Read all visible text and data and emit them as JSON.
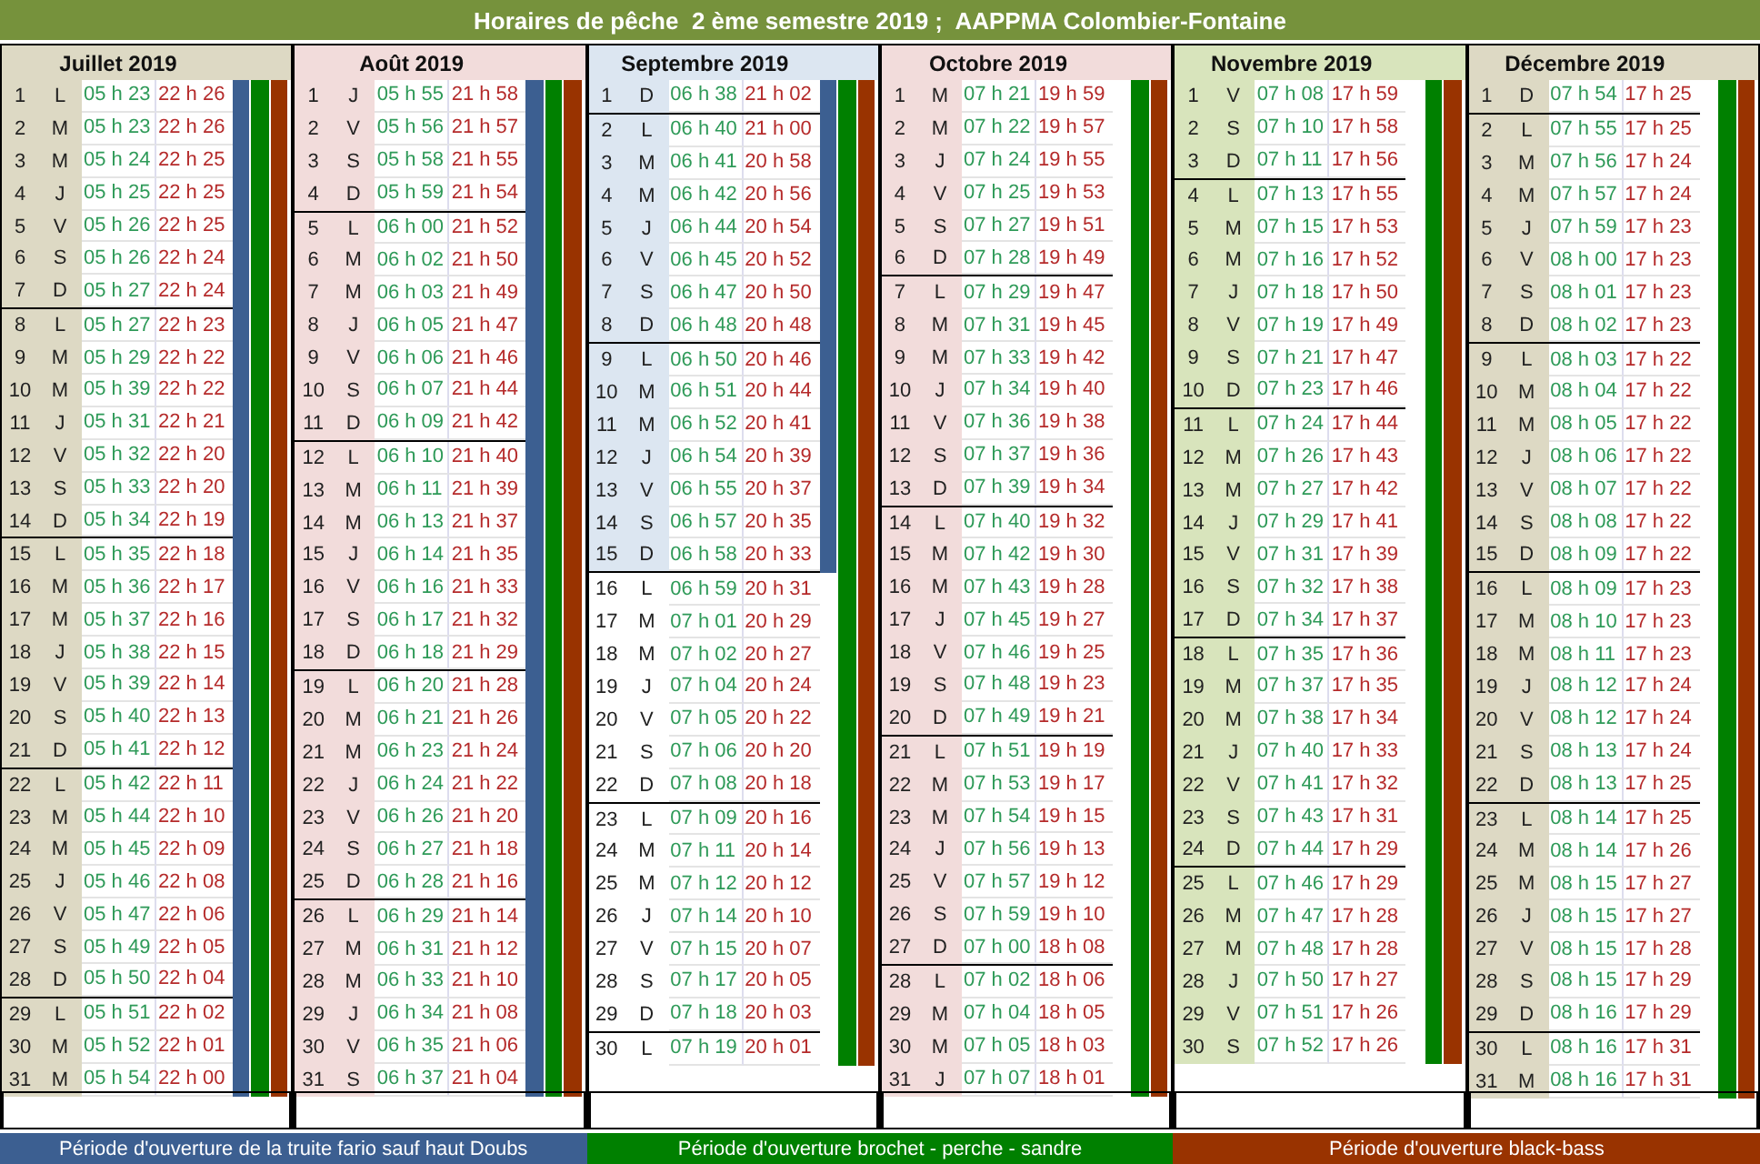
{
  "title": "Horaires de pêche  2 ème semestre 2019 ;  AAPPMA Colombier-Fontaine",
  "months": [
    {
      "name": "Juillet 2019",
      "color": "#ddd9c4",
      "weeks": [
        {
          "shaded": true,
          "trout_open": true,
          "pike_open": true,
          "bass_open": true,
          "days": [
            [
              "1",
              "L",
              "05 h 23",
              "22 h 26"
            ],
            [
              "2",
              "M",
              "05 h 23",
              "22 h 26"
            ],
            [
              "3",
              "M",
              "05 h 24",
              "22 h 25"
            ],
            [
              "4",
              "J",
              "05 h 25",
              "22 h 25"
            ],
            [
              "5",
              "V",
              "05 h 26",
              "22 h 25"
            ],
            [
              "6",
              "S",
              "05 h 26",
              "22 h 24"
            ],
            [
              "7",
              "D",
              "05 h 27",
              "22 h 24"
            ]
          ]
        },
        {
          "shaded": true,
          "trout_open": true,
          "pike_open": true,
          "bass_open": true,
          "days": [
            [
              "8",
              "L",
              "05 h 27",
              "22 h 23"
            ],
            [
              "9",
              "M",
              "05 h 29",
              "22 h 22"
            ],
            [
              "10",
              "M",
              "05 h 39",
              "22 h 22"
            ],
            [
              "11",
              "J",
              "05 h 31",
              "22 h 21"
            ],
            [
              "12",
              "V",
              "05 h 32",
              "22 h 20"
            ],
            [
              "13",
              "S",
              "05 h 33",
              "22 h 20"
            ],
            [
              "14",
              "D",
              "05 h 34",
              "22 h 19"
            ]
          ]
        },
        {
          "shaded": true,
          "trout_open": true,
          "pike_open": true,
          "bass_open": true,
          "days": [
            [
              "15",
              "L",
              "05 h 35",
              "22 h 18"
            ],
            [
              "16",
              "M",
              "05 h 36",
              "22 h 17"
            ],
            [
              "17",
              "M",
              "05 h 37",
              "22 h 16"
            ],
            [
              "18",
              "J",
              "05 h 38",
              "22 h 15"
            ],
            [
              "19",
              "V",
              "05 h 39",
              "22 h 14"
            ],
            [
              "20",
              "S",
              "05 h 40",
              "22 h 13"
            ],
            [
              "21",
              "D",
              "05 h 41",
              "22 h 12"
            ]
          ]
        },
        {
          "shaded": true,
          "trout_open": true,
          "pike_open": true,
          "bass_open": true,
          "days": [
            [
              "22",
              "L",
              "05 h 42",
              "22 h 11"
            ],
            [
              "23",
              "M",
              "05 h 44",
              "22 h 10"
            ],
            [
              "24",
              "M",
              "05 h 45",
              "22 h 09"
            ],
            [
              "25",
              "J",
              "05 h 46",
              "22 h 08"
            ],
            [
              "26",
              "V",
              "05 h 47",
              "22 h 06"
            ],
            [
              "27",
              "S",
              "05 h 49",
              "22 h 05"
            ],
            [
              "28",
              "D",
              "05 h 50",
              "22 h 04"
            ]
          ]
        },
        {
          "shaded": true,
          "trout_open": true,
          "pike_open": true,
          "bass_open": true,
          "days": [
            [
              "29",
              "L",
              "05 h 51",
              "22 h 02"
            ],
            [
              "30",
              "M",
              "05 h 52",
              "22 h 01"
            ],
            [
              "31",
              "M",
              "05 h 54",
              "22 h 00"
            ]
          ]
        }
      ]
    },
    {
      "name": "Août 2019",
      "color": "#f2dcdb",
      "weeks": [
        {
          "shaded": true,
          "trout_open": true,
          "pike_open": true,
          "bass_open": true,
          "days": [
            [
              "1",
              "J",
              "05 h 55",
              "21 h 58"
            ],
            [
              "2",
              "V",
              "05 h 56",
              "21 h 57"
            ],
            [
              "3",
              "S",
              "05 h 58",
              "21 h 55"
            ],
            [
              "4",
              "D",
              "05 h 59",
              "21 h 54"
            ]
          ]
        },
        {
          "shaded": true,
          "trout_open": true,
          "pike_open": true,
          "bass_open": true,
          "days": [
            [
              "5",
              "L",
              "06 h 00",
              "21 h 52"
            ],
            [
              "6",
              "M",
              "06 h 02",
              "21 h 50"
            ],
            [
              "7",
              "M",
              "06 h 03",
              "21 h 49"
            ],
            [
              "8",
              "J",
              "06 h 05",
              "21 h 47"
            ],
            [
              "9",
              "V",
              "06 h 06",
              "21 h 46"
            ],
            [
              "10",
              "S",
              "06 h 07",
              "21 h 44"
            ],
            [
              "11",
              "D",
              "06 h 09",
              "21 h 42"
            ]
          ]
        },
        {
          "shaded": true,
          "trout_open": true,
          "pike_open": true,
          "bass_open": true,
          "days": [
            [
              "12",
              "L",
              "06 h 10",
              "21 h 40"
            ],
            [
              "13",
              "M",
              "06 h 11",
              "21 h 39"
            ],
            [
              "14",
              "M",
              "06 h 13",
              "21 h 37"
            ],
            [
              "15",
              "J",
              "06 h 14",
              "21 h 35"
            ],
            [
              "16",
              "V",
              "06 h 16",
              "21 h 33"
            ],
            [
              "17",
              "S",
              "06 h 17",
              "21 h 32"
            ],
            [
              "18",
              "D",
              "06 h 18",
              "21 h 29"
            ]
          ]
        },
        {
          "shaded": true,
          "trout_open": true,
          "pike_open": true,
          "bass_open": true,
          "days": [
            [
              "19",
              "L",
              "06 h 20",
              "21 h 28"
            ],
            [
              "20",
              "M",
              "06 h 21",
              "21 h 26"
            ],
            [
              "21",
              "M",
              "06 h 23",
              "21 h 24"
            ],
            [
              "22",
              "J",
              "06 h 24",
              "21 h 22"
            ],
            [
              "23",
              "V",
              "06 h 26",
              "21 h 20"
            ],
            [
              "24",
              "S",
              "06 h 27",
              "21 h 18"
            ],
            [
              "25",
              "D",
              "06 h 28",
              "21 h 16"
            ]
          ]
        },
        {
          "shaded": true,
          "trout_open": true,
          "pike_open": true,
          "bass_open": true,
          "days": [
            [
              "26",
              "L",
              "06 h 29",
              "21 h 14"
            ],
            [
              "27",
              "M",
              "06 h 31",
              "21 h 12"
            ],
            [
              "28",
              "M",
              "06 h 33",
              "21 h 10"
            ],
            [
              "29",
              "J",
              "06 h 34",
              "21 h 08"
            ],
            [
              "30",
              "V",
              "06 h 35",
              "21 h 06"
            ],
            [
              "31",
              "S",
              "06 h 37",
              "21 h 04"
            ]
          ]
        }
      ]
    },
    {
      "name": "Septembre 2019",
      "color": "#dce6f1",
      "weeks": [
        {
          "shaded": true,
          "trout_open": true,
          "pike_open": true,
          "bass_open": true,
          "days": [
            [
              "1",
              "D",
              "06 h 38",
              "21 h 02"
            ]
          ]
        },
        {
          "shaded": true,
          "trout_open": true,
          "pike_open": true,
          "bass_open": true,
          "days": [
            [
              "2",
              "L",
              "06 h 40",
              "21 h 00"
            ],
            [
              "3",
              "M",
              "06 h 41",
              "20 h 58"
            ],
            [
              "4",
              "M",
              "06 h 42",
              "20 h 56"
            ],
            [
              "5",
              "J",
              "06 h 44",
              "20 h 54"
            ],
            [
              "6",
              "V",
              "06 h 45",
              "20 h 52"
            ],
            [
              "7",
              "S",
              "06 h 47",
              "20 h 50"
            ],
            [
              "8",
              "D",
              "06 h 48",
              "20 h 48"
            ]
          ]
        },
        {
          "shaded": true,
          "trout_open": true,
          "pike_open": true,
          "bass_open": true,
          "days": [
            [
              "9",
              "L",
              "06 h 50",
              "20 h 46"
            ],
            [
              "10",
              "M",
              "06 h 51",
              "20 h 44"
            ],
            [
              "11",
              "M",
              "06 h 52",
              "20 h 41"
            ],
            [
              "12",
              "J",
              "06 h 54",
              "20 h 39"
            ],
            [
              "13",
              "V",
              "06 h 55",
              "20 h 37"
            ],
            [
              "14",
              "S",
              "06 h 57",
              "20 h 35"
            ],
            [
              "15",
              "D",
              "06 h 58",
              "20 h 33"
            ]
          ]
        },
        {
          "shaded": false,
          "trout_open": false,
          "pike_open": true,
          "bass_open": true,
          "days": [
            [
              "16",
              "L",
              "06 h 59",
              "20 h 31"
            ],
            [
              "17",
              "M",
              "07 h 01",
              "20 h 29"
            ],
            [
              "18",
              "M",
              "07 h 02",
              "20 h 27"
            ],
            [
              "19",
              "J",
              "07 h 04",
              "20 h 24"
            ],
            [
              "20",
              "V",
              "07 h 05",
              "20 h 22"
            ],
            [
              "21",
              "S",
              "07 h 06",
              "20 h 20"
            ],
            [
              "22",
              "D",
              "07 h 08",
              "20 h 18"
            ]
          ]
        },
        {
          "shaded": false,
          "trout_open": false,
          "pike_open": true,
          "bass_open": true,
          "days": [
            [
              "23",
              "L",
              "07 h 09",
              "20 h 16"
            ],
            [
              "24",
              "M",
              "07 h 11",
              "20 h 14"
            ],
            [
              "25",
              "M",
              "07 h 12",
              "20 h 12"
            ],
            [
              "26",
              "J",
              "07 h 14",
              "20 h 10"
            ],
            [
              "27",
              "V",
              "07 h 15",
              "20 h 07"
            ],
            [
              "28",
              "S",
              "07 h 17",
              "20 h 05"
            ],
            [
              "29",
              "D",
              "07 h 18",
              "20 h 03"
            ]
          ]
        },
        {
          "shaded": false,
          "trout_open": false,
          "pike_open": true,
          "bass_open": true,
          "days": [
            [
              "30",
              "L",
              "07 h 19",
              "20 h 01"
            ]
          ]
        }
      ]
    },
    {
      "name": "Octobre 2019",
      "color": "#f2dcdb",
      "weeks": [
        {
          "shaded": true,
          "trout_open": false,
          "pike_open": true,
          "bass_open": true,
          "days": [
            [
              "1",
              "M",
              "07 h 21",
              "19 h 59"
            ],
            [
              "2",
              "M",
              "07 h 22",
              "19 h 57"
            ],
            [
              "3",
              "J",
              "07 h 24",
              "19 h 55"
            ],
            [
              "4",
              "V",
              "07 h 25",
              "19 h 53"
            ],
            [
              "5",
              "S",
              "07 h 27",
              "19 h 51"
            ],
            [
              "6",
              "D",
              "07 h 28",
              "19 h 49"
            ]
          ]
        },
        {
          "shaded": true,
          "trout_open": false,
          "pike_open": true,
          "bass_open": true,
          "days": [
            [
              "7",
              "L",
              "07 h 29",
              "19 h 47"
            ],
            [
              "8",
              "M",
              "07 h 31",
              "19 h 45"
            ],
            [
              "9",
              "M",
              "07 h 33",
              "19 h 42"
            ],
            [
              "10",
              "J",
              "07 h 34",
              "19 h 40"
            ],
            [
              "11",
              "V",
              "07 h 36",
              "19 h 38"
            ],
            [
              "12",
              "S",
              "07 h 37",
              "19 h 36"
            ],
            [
              "13",
              "D",
              "07 h 39",
              "19 h 34"
            ]
          ]
        },
        {
          "shaded": true,
          "trout_open": false,
          "pike_open": true,
          "bass_open": true,
          "days": [
            [
              "14",
              "L",
              "07 h 40",
              "19 h 32"
            ],
            [
              "15",
              "M",
              "07 h 42",
              "19 h 30"
            ],
            [
              "16",
              "M",
              "07 h 43",
              "19 h 28"
            ],
            [
              "17",
              "J",
              "07 h 45",
              "19 h 27"
            ],
            [
              "18",
              "V",
              "07 h 46",
              "19 h 25"
            ],
            [
              "19",
              "S",
              "07 h 48",
              "19 h 23"
            ],
            [
              "20",
              "D",
              "07 h 49",
              "19 h 21"
            ]
          ]
        },
        {
          "shaded": true,
          "trout_open": false,
          "pike_open": true,
          "bass_open": true,
          "days": [
            [
              "21",
              "L",
              "07 h 51",
              "19 h 19"
            ],
            [
              "22",
              "M",
              "07 h 53",
              "19 h 17"
            ],
            [
              "23",
              "M",
              "07 h 54",
              "19 h 15"
            ],
            [
              "24",
              "J",
              "07 h 56",
              "19 h 13"
            ],
            [
              "25",
              "V",
              "07 h 57",
              "19 h 12"
            ],
            [
              "26",
              "S",
              "07 h 59",
              "19 h 10"
            ],
            [
              "27",
              "D",
              "07 h 00",
              "18 h 08"
            ]
          ]
        },
        {
          "shaded": true,
          "trout_open": false,
          "pike_open": true,
          "bass_open": true,
          "days": [
            [
              "28",
              "L",
              "07 h 02",
              "18 h 06"
            ],
            [
              "29",
              "M",
              "07 h 04",
              "18 h 05"
            ],
            [
              "30",
              "M",
              "07 h 05",
              "18 h 03"
            ],
            [
              "31",
              "J",
              "07 h 07",
              "18 h 01"
            ]
          ]
        }
      ]
    },
    {
      "name": "Novembre 2019",
      "color": "#d8e4bc",
      "weeks": [
        {
          "shaded": true,
          "trout_open": false,
          "pike_open": true,
          "bass_open": true,
          "days": [
            [
              "1",
              "V",
              "07 h 08",
              "17 h 59"
            ],
            [
              "2",
              "S",
              "07 h 10",
              "17 h 58"
            ],
            [
              "3",
              "D",
              "07 h 11",
              "17 h 56"
            ]
          ]
        },
        {
          "shaded": true,
          "trout_open": false,
          "pike_open": true,
          "bass_open": true,
          "days": [
            [
              "4",
              "L",
              "07 h 13",
              "17 h 55"
            ],
            [
              "5",
              "M",
              "07 h 15",
              "17 h 53"
            ],
            [
              "6",
              "M",
              "07 h 16",
              "17 h 52"
            ],
            [
              "7",
              "J",
              "07 h 18",
              "17 h 50"
            ],
            [
              "8",
              "V",
              "07 h 19",
              "17 h 49"
            ],
            [
              "9",
              "S",
              "07 h 21",
              "17 h 47"
            ],
            [
              "10",
              "D",
              "07 h 23",
              "17 h 46"
            ]
          ]
        },
        {
          "shaded": true,
          "trout_open": false,
          "pike_open": true,
          "bass_open": true,
          "days": [
            [
              "11",
              "L",
              "07 h 24",
              "17 h 44"
            ],
            [
              "12",
              "M",
              "07 h 26",
              "17 h 43"
            ],
            [
              "13",
              "M",
              "07 h 27",
              "17 h 42"
            ],
            [
              "14",
              "J",
              "07 h 29",
              "17 h 41"
            ],
            [
              "15",
              "V",
              "07 h 31",
              "17 h 39"
            ],
            [
              "16",
              "S",
              "07 h 32",
              "17 h 38"
            ],
            [
              "17",
              "D",
              "07 h 34",
              "17 h 37"
            ]
          ]
        },
        {
          "shaded": true,
          "trout_open": false,
          "pike_open": true,
          "bass_open": true,
          "days": [
            [
              "18",
              "L",
              "07 h 35",
              "17 h 36"
            ],
            [
              "19",
              "M",
              "07 h 37",
              "17 h 35"
            ],
            [
              "20",
              "M",
              "07 h 38",
              "17 h 34"
            ],
            [
              "21",
              "J",
              "07 h 40",
              "17 h 33"
            ],
            [
              "22",
              "V",
              "07 h 41",
              "17 h 32"
            ],
            [
              "23",
              "S",
              "07 h 43",
              "17 h 31"
            ],
            [
              "24",
              "D",
              "07 h 44",
              "17 h 29"
            ]
          ]
        },
        {
          "shaded": true,
          "trout_open": false,
          "pike_open": true,
          "bass_open": true,
          "days": [
            [
              "25",
              "L",
              "07 h 46",
              "17 h 29"
            ],
            [
              "26",
              "M",
              "07 h 47",
              "17 h 28"
            ],
            [
              "27",
              "M",
              "07 h 48",
              "17 h 28"
            ],
            [
              "28",
              "J",
              "07 h 50",
              "17 h 27"
            ],
            [
              "29",
              "V",
              "07 h 51",
              "17 h 26"
            ],
            [
              "30",
              "S",
              "07 h 52",
              "17 h 26"
            ]
          ]
        }
      ]
    },
    {
      "name": "Décembre 2019",
      "color": "#ddd9c4",
      "weeks": [
        {
          "shaded": true,
          "trout_open": false,
          "pike_open": true,
          "bass_open": true,
          "days": [
            [
              "1",
              "D",
              "07 h 54",
              "17 h 25"
            ]
          ]
        },
        {
          "shaded": true,
          "trout_open": false,
          "pike_open": true,
          "bass_open": true,
          "days": [
            [
              "2",
              "L",
              "07 h 55",
              "17 h 25"
            ],
            [
              "3",
              "M",
              "07 h 56",
              "17 h 24"
            ],
            [
              "4",
              "M",
              "07 h 57",
              "17 h 24"
            ],
            [
              "5",
              "J",
              "07 h 59",
              "17 h 23"
            ],
            [
              "6",
              "V",
              "08 h 00",
              "17 h 23"
            ],
            [
              "7",
              "S",
              "08 h 01",
              "17 h 23"
            ],
            [
              "8",
              "D",
              "08 h 02",
              "17 h 23"
            ]
          ]
        },
        {
          "shaded": true,
          "trout_open": false,
          "pike_open": true,
          "bass_open": true,
          "days": [
            [
              "9",
              "L",
              "08 h 03",
              "17 h 22"
            ],
            [
              "10",
              "M",
              "08 h 04",
              "17 h 22"
            ],
            [
              "11",
              "M",
              "08 h 05",
              "17 h 22"
            ],
            [
              "12",
              "J",
              "08 h 06",
              "17 h 22"
            ],
            [
              "13",
              "V",
              "08 h 07",
              "17 h 22"
            ],
            [
              "14",
              "S",
              "08 h 08",
              "17 h 22"
            ],
            [
              "15",
              "D",
              "08 h 09",
              "17 h 22"
            ]
          ]
        },
        {
          "shaded": true,
          "trout_open": false,
          "pike_open": true,
          "bass_open": true,
          "days": [
            [
              "16",
              "L",
              "08 h 09",
              "17 h 23"
            ],
            [
              "17",
              "M",
              "08 h 10",
              "17 h 23"
            ],
            [
              "18",
              "M",
              "08 h 11",
              "17 h 23"
            ],
            [
              "19",
              "J",
              "08 h 12",
              "17 h 24"
            ],
            [
              "20",
              "V",
              "08 h 12",
              "17 h 24"
            ],
            [
              "21",
              "S",
              "08 h 13",
              "17 h 24"
            ],
            [
              "22",
              "D",
              "08 h 13",
              "17 h 25"
            ]
          ]
        },
        {
          "shaded": true,
          "trout_open": false,
          "pike_open": true,
          "bass_open": true,
          "days": [
            [
              "23",
              "L",
              "08 h 14",
              "17 h 25"
            ],
            [
              "24",
              "M",
              "08 h 14",
              "17 h 26"
            ],
            [
              "25",
              "M",
              "08 h 15",
              "17 h 27"
            ],
            [
              "26",
              "J",
              "08 h 15",
              "17 h 27"
            ],
            [
              "27",
              "V",
              "08 h 15",
              "17 h 28"
            ],
            [
              "28",
              "S",
              "08 h 15",
              "17 h 29"
            ],
            [
              "29",
              "D",
              "08 h 16",
              "17 h 29"
            ]
          ]
        },
        {
          "shaded": true,
          "trout_open": false,
          "pike_open": true,
          "bass_open": true,
          "days": [
            [
              "30",
              "L",
              "08 h 16",
              "17 h 31"
            ],
            [
              "31",
              "M",
              "08 h 16",
              "17 h 31"
            ]
          ]
        }
      ]
    }
  ],
  "legend": [
    {
      "label": "Période d'ouverture de la truite fario sauf haut Doubs",
      "color": "#3c5f91"
    },
    {
      "label": "Période d'ouverture brochet - perche - sandre",
      "color": "#008000"
    },
    {
      "label": "Période d'ouverture black-bass",
      "color": "#993300"
    }
  ]
}
